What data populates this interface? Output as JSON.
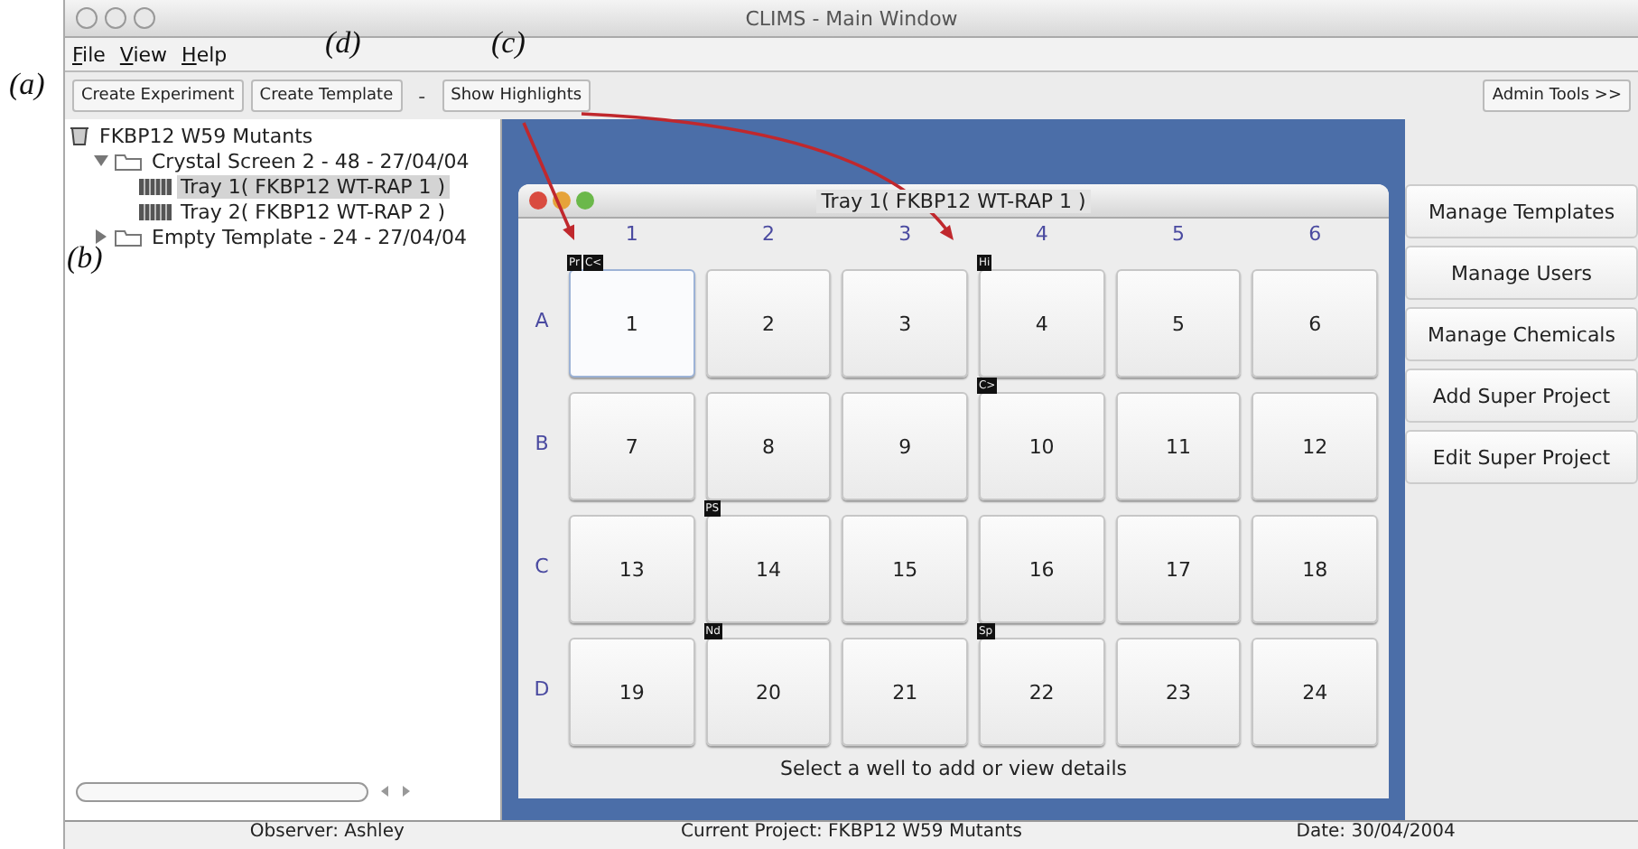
{
  "window": {
    "title": "CLIMS - Main Window"
  },
  "menu": [
    {
      "label": "File"
    },
    {
      "label": "View"
    },
    {
      "label": "Help"
    }
  ],
  "toolbar": {
    "buttons": [
      {
        "label": "Create Experiment"
      },
      {
        "label": "Create Template"
      }
    ],
    "separator": "-",
    "highlight_button": "Show Highlights",
    "admin_button": "Admin Tools >>"
  },
  "annotations": [
    {
      "label": "(a)"
    },
    {
      "label": "(b)"
    },
    {
      "label": "(c)"
    },
    {
      "label": "(d)"
    }
  ],
  "tree": {
    "label": "FKBP12 W59 Mutants",
    "kind": "project",
    "children": [
      {
        "label": "Crystal Screen 2 - 48 - 27/04/04",
        "kind": "screen",
        "expanded": true,
        "children": [
          {
            "label": "Tray 1( FKBP12 WT-RAP 1 )",
            "kind": "tray",
            "selected": true
          },
          {
            "label": "Tray 2( FKBP12 WT-RAP 2 )",
            "kind": "tray",
            "selected": false
          }
        ]
      },
      {
        "label": "Empty Template - 24 - 27/04/04",
        "kind": "screen",
        "expanded": false
      }
    ]
  },
  "tray": {
    "title": "Tray 1( FKBP12 WT-RAP 1 )",
    "columns": [
      "1",
      "2",
      "3",
      "4",
      "5",
      "6"
    ],
    "rows": [
      {
        "label": "A",
        "wells": [
          {
            "number": "1",
            "tags": [
              "Pr",
              "C<"
            ],
            "selected": true
          },
          {
            "number": "2",
            "selected": false
          },
          {
            "number": "3",
            "selected": false
          },
          {
            "number": "4",
            "tags": [
              "Hi"
            ],
            "selected": false
          },
          {
            "number": "5",
            "selected": false
          },
          {
            "number": "6",
            "selected": false
          }
        ]
      },
      {
        "label": "B",
        "wells": [
          {
            "number": "7",
            "selected": false
          },
          {
            "number": "8",
            "selected": false
          },
          {
            "number": "9",
            "selected": false
          },
          {
            "number": "10",
            "tags": [
              "C>"
            ],
            "selected": false
          },
          {
            "number": "11",
            "selected": false
          },
          {
            "number": "12",
            "selected": false
          }
        ]
      },
      {
        "label": "C",
        "wells": [
          {
            "number": "13",
            "selected": false
          },
          {
            "number": "14",
            "tags": [
              "PS"
            ],
            "selected": false
          },
          {
            "number": "15",
            "selected": false
          },
          {
            "number": "16",
            "selected": false
          },
          {
            "number": "17",
            "selected": false
          },
          {
            "number": "18",
            "selected": false
          }
        ]
      },
      {
        "label": "D",
        "wells": [
          {
            "number": "19",
            "selected": false
          },
          {
            "number": "20",
            "tags": [
              "Nd"
            ],
            "selected": false
          },
          {
            "number": "21",
            "selected": false
          },
          {
            "number": "22",
            "tags": [
              "Sp"
            ],
            "selected": false
          },
          {
            "number": "23",
            "selected": false
          },
          {
            "number": "24",
            "selected": false
          }
        ]
      }
    ],
    "hint": "Select a well to add or view details"
  },
  "side_buttons": [
    {
      "label": "Manage Templates"
    },
    {
      "label": "Manage Users"
    },
    {
      "label": "Manage Chemicals"
    },
    {
      "label": "Add Super Project"
    },
    {
      "label": "Edit Super Project"
    }
  ],
  "status_bar": [
    "Observer: Ashley",
    "Current Project: FKBP12 W59 Mutants",
    "Date: 30/04/2004"
  ]
}
